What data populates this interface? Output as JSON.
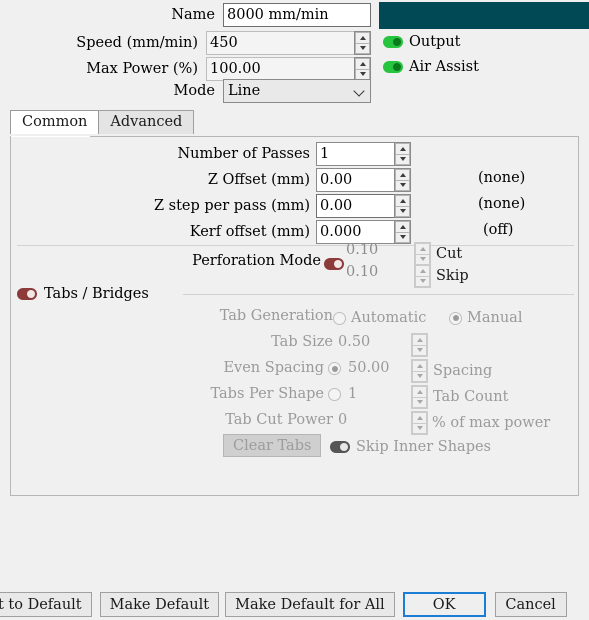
{
  "header": {
    "name_label": "Name",
    "name_value": "8000 mm/min",
    "speed_label": "Speed (mm/min)",
    "speed_value": "450",
    "maxpower_label": "Max Power (%)",
    "maxpower_value": "100.00",
    "mode_label": "Mode",
    "mode_value": "Line",
    "output_label": "Output",
    "output_state": "on",
    "airassist_label": "Air Assist",
    "airassist_state": "on",
    "layer_color": "#014a55"
  },
  "tabs": [
    {
      "label": "Common",
      "active": true
    },
    {
      "label": "Advanced",
      "active": false
    }
  ],
  "common": {
    "rows": [
      {
        "label": "Number of Passes",
        "value": "1",
        "suffix": ""
      },
      {
        "label": "Z Offset (mm)",
        "value": "0.00",
        "suffix": "(none)"
      },
      {
        "label": "Z step per pass (mm)",
        "value": "0.00",
        "suffix": "(none)"
      },
      {
        "label": "Kerf offset (mm)",
        "value": "0.000",
        "suffix": "(off)"
      }
    ],
    "perforation": {
      "label": "Perforation Mode",
      "state": "off",
      "cut_value": "0.10",
      "cut_label": "Cut",
      "skip_value": "0.10",
      "skip_label": "Skip"
    },
    "tabs_bridges": {
      "group_label": "Tabs / Bridges",
      "group_state": "off",
      "tab_generation_label": "Tab Generation",
      "automatic_label": "Automatic",
      "automatic_selected": false,
      "manual_label": "Manual",
      "manual_selected": true,
      "tab_size_label": "Tab Size",
      "tab_size_value": "0.50",
      "even_spacing_label": "Even Spacing",
      "even_spacing_selected": true,
      "spacing_value": "50.00",
      "spacing_unit_label": "Spacing",
      "tabs_per_shape_label": "Tabs Per Shape",
      "tabs_per_shape_selected": false,
      "tab_count_value": "1",
      "tab_count_unit_label": "Tab Count",
      "tab_cut_power_label": "Tab Cut Power",
      "tab_cut_power_value": "0",
      "tab_cut_power_unit_label": "% of max power",
      "clear_tabs_label": "Clear Tabs",
      "skip_inner_label": "Skip Inner Shapes",
      "skip_inner_state": "off"
    }
  },
  "footer": {
    "reset_default_label": "t to Default",
    "make_default_label": "Make Default",
    "make_default_all_label": "Make Default for All",
    "ok_label": "OK",
    "cancel_label": "Cancel"
  }
}
